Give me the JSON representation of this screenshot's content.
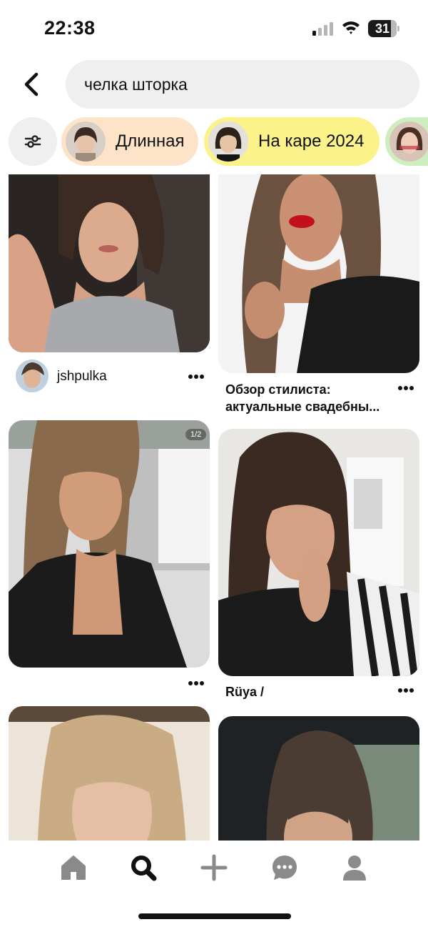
{
  "status_bar": {
    "time": "22:38",
    "battery_level": "31",
    "icons": [
      "signal-icon",
      "wifi-icon",
      "battery-icon"
    ]
  },
  "header": {
    "back_icon": "chevron-left-icon",
    "search_query": "челка шторка"
  },
  "chips": {
    "filter_icon": "sliders-icon",
    "items": [
      {
        "label": "Длинная",
        "color": "#fde3c8"
      },
      {
        "label": "На каре 2024",
        "color": "#fbf28a"
      },
      {
        "label": "",
        "color": "#cfeec0"
      }
    ]
  },
  "feed": {
    "pins": [
      {
        "username": "jshpulka",
        "more_icon": "more-horizontal-icon"
      },
      {
        "title_line1": "Обзор стилиста:",
        "title_line2": "актуальные свадебны...",
        "more_icon": "more-horizontal-icon"
      },
      {
        "badge": "1/2",
        "more_icon": "more-horizontal-icon"
      },
      {
        "title": "Rüya /",
        "more_icon": "more-horizontal-icon"
      },
      {},
      {}
    ]
  },
  "bottom_nav": {
    "items": [
      "home-icon",
      "search-icon",
      "plus-icon",
      "chat-icon",
      "profile-icon"
    ],
    "active": "search-icon"
  }
}
